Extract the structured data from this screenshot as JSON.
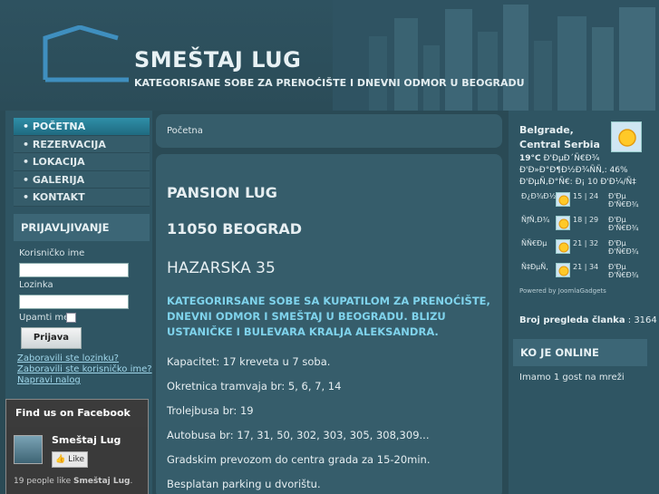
{
  "header": {
    "title": "SMEŠTAJ LUG",
    "subtitle": "KATEGORISANE SOBE ZA PRENOĆIŠTE I DNEVNI ODMOR U BEOGRADU"
  },
  "nav": {
    "items": [
      {
        "label": "• POČETNA",
        "active": true
      },
      {
        "label": "• REZERVACIJA",
        "active": false
      },
      {
        "label": "• LOKACIJA",
        "active": false
      },
      {
        "label": "• GALERIJA",
        "active": false
      },
      {
        "label": "• KONTAKT",
        "active": false
      }
    ]
  },
  "login": {
    "heading": "PRIJAVLJIVANJE",
    "username_label": "Korisničko ime",
    "password_label": "Lozinka",
    "remember_label": "Upamti me",
    "submit_label": "Prijava",
    "forgot_password": "Zaboravili ste lozinku?",
    "forgot_username": "Zaboravili ste korisničko ime?",
    "register": "Napravi nalog"
  },
  "facebook": {
    "heading": "Find us on Facebook",
    "page_name": "Smeštaj Lug",
    "like_label": "Like",
    "count_prefix": "19 people like ",
    "count_name": "Smeštaj Lug",
    "count_suffix": "."
  },
  "breadcrumb": "Početna",
  "content": {
    "heading1": "PANSION LUG",
    "heading2": "11050 BEOGRAD",
    "heading3": "HAZARSKA 35",
    "highlight": "KATEGORIRSANE SOBE SA KUPATILOM ZA PRENOĆIŠTE, DNEVNI ODMOR I SMEŠTAJ U BEOGRADU. BLIZU USTANIČKE I BULEVARA KRALJA ALEKSANDRA.",
    "info": [
      "Kapacitet: 17 kreveta u 7 soba.",
      "Okretnica tramvaja br: 5, 6, 7, 14",
      "Trolejbusa br: 19",
      "Autobusa br: 17, 31, 50, 302, 303, 305, 308,309...",
      "Gradskim prevozom do centra grada za 15-20min.",
      "Besplatan parking u dvorištu."
    ]
  },
  "weather": {
    "city": "Belgrade, Central Serbia",
    "temp": "19°C",
    "current_line1": "Ð'ÐµÐ´Ñ€Ð¾",
    "current_line2": "Ð'Ð»Ð°Ð¶Ð½Ð¾ÑÑ‚: 46%",
    "current_line3": "Ð'ÐµÑ‚Ð°Ñ€: Ð¡ 10 Ð'Ð¼/Ñ‡",
    "forecast": [
      {
        "day": "Ð¿Ð¾Ð½",
        "range": "15 | 24",
        "desc": "Ð'Ðµ Ð'Ñ€Ð¾"
      },
      {
        "day": "ÑƒÑ‚Ð¾",
        "range": "18 | 29",
        "desc": "Ð'Ðµ Ð'Ñ€Ð¾"
      },
      {
        "day": "ÑÑ€Ðµ",
        "range": "21 | 32",
        "desc": "Ð'Ðµ Ð'Ñ€Ð¾"
      },
      {
        "day": "Ñ‡ÐµÑ‚",
        "range": "21 | 34",
        "desc": "Ð'Ðµ Ð'Ñ€Ð¾"
      }
    ],
    "powered": "Powered by JoomlaGadgets",
    "icon": "sun-icon"
  },
  "stats": {
    "views_label": "Broj pregleda članka",
    "views_value": " : 3164"
  },
  "online": {
    "heading": "KO JE ONLINE",
    "text": "Imamo 1 gost na mreži"
  }
}
